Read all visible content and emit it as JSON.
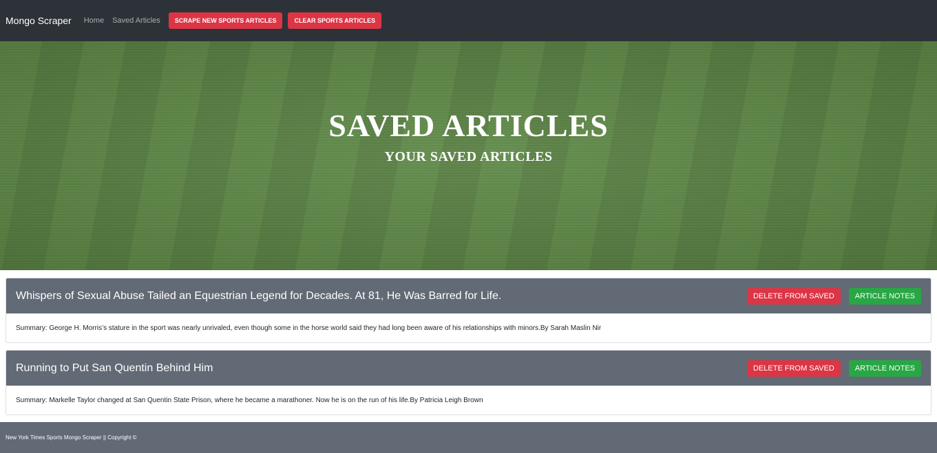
{
  "navbar": {
    "brand": "Mongo Scraper",
    "links": [
      "Home",
      "Saved Articles"
    ],
    "scrape_button": "SCRAPE NEW SPORTS ARTICLES",
    "clear_button": "CLEAR SPORTS ARTICLES"
  },
  "hero": {
    "title": "SAVED ARTICLES",
    "subtitle": "YOUR SAVED ARTICLES"
  },
  "articles": [
    {
      "title": "Whispers of Sexual Abuse Tailed an Equestrian Legend for Decades. At 81, He Was Barred for Life.",
      "summary": "Summary: George H. Morris’s stature in the sport was nearly unrivaled, even though some in the horse world said they had long been aware of his relationships with minors.By Sarah Maslin Nir",
      "delete_label": "DELETE FROM SAVED",
      "notes_label": "ARTICLE NOTES"
    },
    {
      "title": "Running to Put San Quentin Behind Him",
      "summary": "Summary: Markelle Taylor changed at San Quentin State Prison, where he became a marathoner. Now he is on the run of his life.By Patricia Leigh Brown",
      "delete_label": "DELETE FROM SAVED",
      "notes_label": "ARTICLE NOTES"
    }
  ],
  "footer": {
    "text": "New York Times Sports Mongo Scraper || Copyright ©"
  },
  "colors": {
    "navbar": "#2d3238",
    "danger": "#dc3545",
    "success": "#28a745",
    "card_header": "#626a75",
    "hero_grass": "#5f8a47"
  }
}
